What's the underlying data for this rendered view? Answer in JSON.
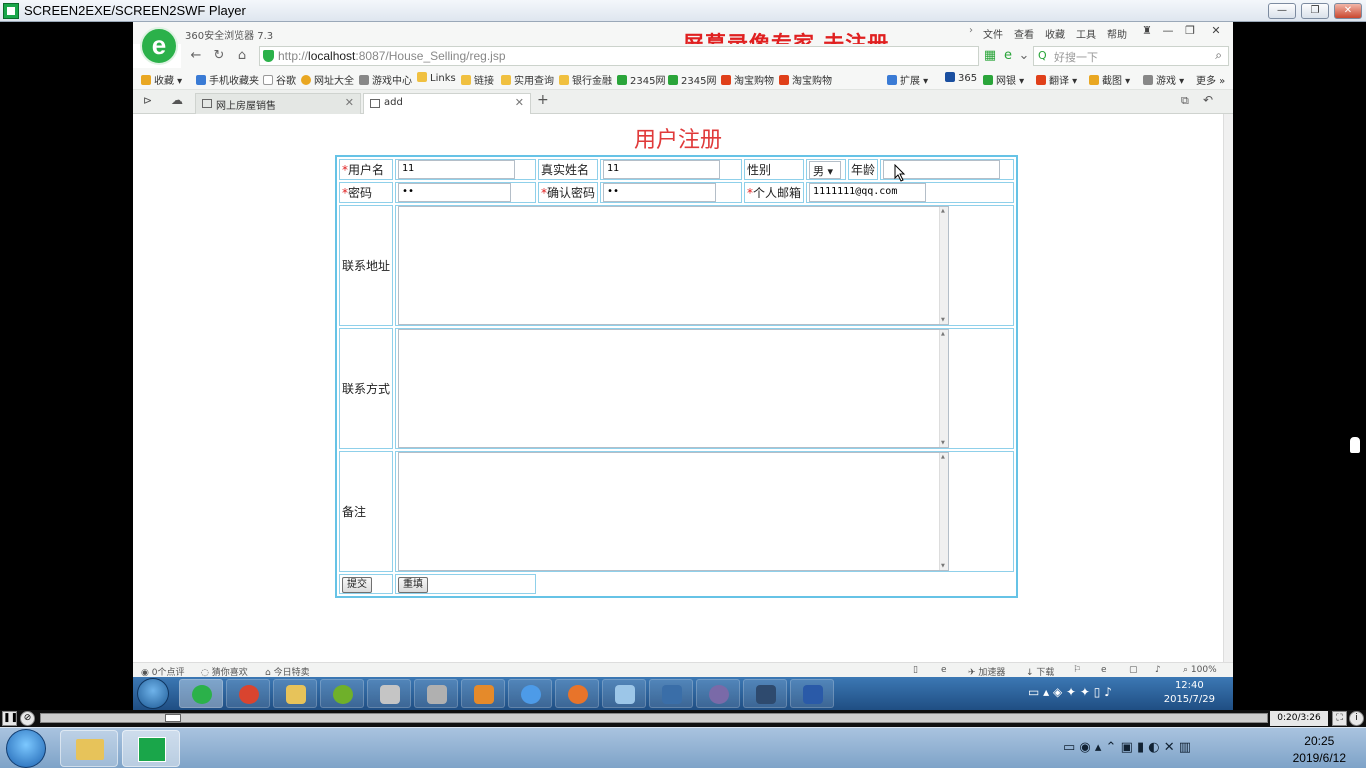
{
  "player": {
    "title": "SCREEN2EXE/SCREEN2SWF Player",
    "time": "0:20/3:26",
    "controls": {
      "play_pause": "❚❚",
      "fullscreen": "⛶",
      "info": "i"
    }
  },
  "browser": {
    "name_version": "360安全浏览器 7.3",
    "menu": [
      "文件",
      "查看",
      "收藏",
      "工具",
      "帮助"
    ],
    "watermark": "屏幕录像专家  未注册",
    "url_prefix": "http://",
    "url_host": "localhost",
    "url_rest": ":8087/House_Selling/reg.jsp",
    "search_placeholder": "好搜一下",
    "favorites": [
      {
        "label": "收藏",
        "color": "#e9a722"
      },
      {
        "label": "手机收藏夹",
        "color": "#3a7bd5"
      },
      {
        "label": "谷歌",
        "color": "#ffffff"
      },
      {
        "label": "网址大全",
        "color": "#e9a722"
      },
      {
        "label": "游戏中心",
        "color": "#888888"
      },
      {
        "label": "Links",
        "color": "#f0c040"
      },
      {
        "label": "链接",
        "color": "#f0c040"
      },
      {
        "label": "实用查询",
        "color": "#f0c040"
      },
      {
        "label": "银行金融",
        "color": "#f0c040"
      },
      {
        "label": "2345网",
        "color": "#2aa53a"
      },
      {
        "label": "2345网",
        "color": "#2aa53a"
      },
      {
        "label": "淘宝购物",
        "color": "#e0401a"
      },
      {
        "label": "淘宝购物",
        "color": "#e0401a"
      }
    ],
    "fav_right": [
      {
        "label": "扩展",
        "color": "#3a7bd5"
      },
      {
        "label": "365",
        "color": "#1a4fa0"
      },
      {
        "label": "网银",
        "color": "#2aa53a"
      },
      {
        "label": "翻译",
        "color": "#e0401a"
      },
      {
        "label": "截图",
        "color": "#e9a722"
      },
      {
        "label": "游戏",
        "color": "#888888"
      },
      {
        "label": "更多",
        "color": "#888888"
      }
    ],
    "tabs": [
      {
        "label": "网上房屋销售",
        "active": false
      },
      {
        "label": "add",
        "active": true
      }
    ],
    "status_left": [
      "0个点评",
      "猜你喜欢",
      "今日特卖"
    ],
    "status_right": [
      "加速器",
      "下载",
      "100%"
    ],
    "inner_clock": {
      "time": "12:40",
      "date": "2015/7/29"
    }
  },
  "form": {
    "title": "用户注册",
    "labels": {
      "username": "用户名",
      "realname": "真实姓名",
      "gender": "性别",
      "age": "年龄",
      "password": "密码",
      "confirm": "确认密码",
      "email": "个人邮箱",
      "address": "联系地址",
      "contact": "联系方式",
      "remark": "备注"
    },
    "required_mark": "*",
    "values": {
      "username": "11",
      "realname": "11",
      "gender": "男",
      "age": "",
      "password": "••",
      "confirm": "••",
      "email": "1111111@qq.com"
    },
    "buttons": {
      "submit": "提交",
      "reset": "重填"
    }
  },
  "host_clock": {
    "time": "20:25",
    "date": "2019/6/12"
  }
}
